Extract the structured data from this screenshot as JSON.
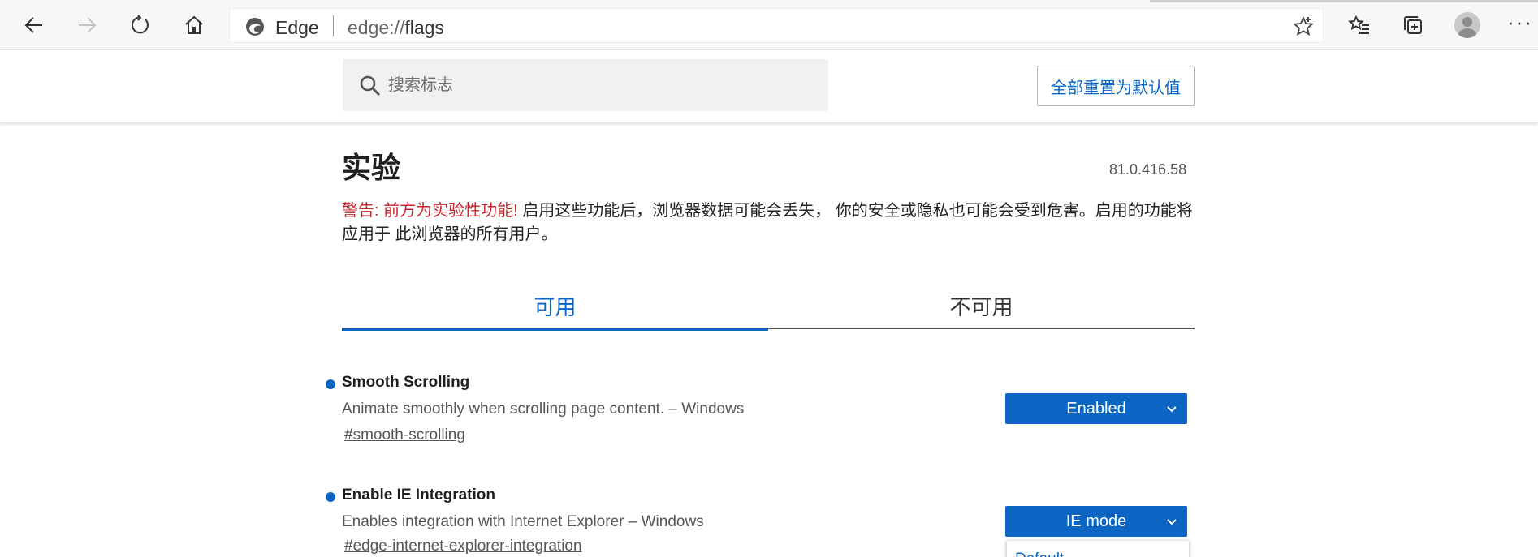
{
  "browser": {
    "site_label": "Edge",
    "url_prefix": "edge://",
    "url_path": "flags",
    "icons": [
      "back-icon",
      "forward-icon",
      "refresh-icon",
      "home-icon",
      "edge-logo-icon",
      "favorite-star-icon",
      "favorites-list-icon",
      "collections-icon",
      "profile-avatar-icon",
      "more-icon"
    ],
    "more_label": "···"
  },
  "header": {
    "search_placeholder": "搜索标志",
    "reset_label": "全部重置为默认值"
  },
  "page": {
    "title": "实验",
    "version": "81.0.416.58",
    "warning_label": "警告: 前方为实验性功能!",
    "warning_text": " 启用这些功能后，浏览器数据可能会丢失， 你的安全或隐私也可能会受到危害。启用的功能将应用于 此浏览器的所有用户。"
  },
  "tabs": [
    {
      "label": "可用",
      "active": true
    },
    {
      "label": "不可用",
      "active": false
    }
  ],
  "flags": [
    {
      "title": "Smooth Scrolling",
      "description": "Animate smoothly when scrolling page content. – Windows",
      "link": "#smooth-scrolling",
      "value": "Enabled"
    },
    {
      "title": "Enable IE Integration",
      "description": "Enables integration with Internet Explorer – Windows",
      "link": "#edge-internet-explorer-integration",
      "value": "IE mode",
      "dropdown_first_option": "Default"
    }
  ],
  "colors": {
    "accent": "#0a66c2",
    "warning": "#c4262e",
    "toolbar_bg": "#f7f7f7"
  }
}
